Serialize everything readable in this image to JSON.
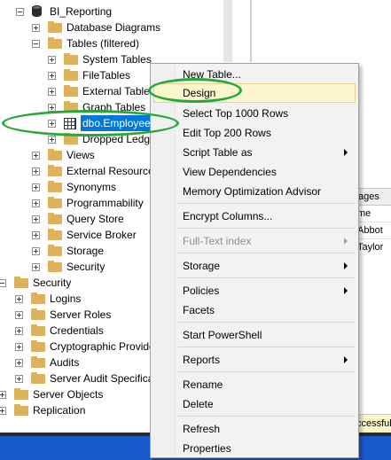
{
  "tree": {
    "items": [
      {
        "label": "BI_Reporting",
        "icon": "database-icon",
        "expander": "minus"
      },
      {
        "label": "Database Diagrams",
        "icon": "folder-icon",
        "expander": "plus"
      },
      {
        "label": "Tables (filtered)",
        "icon": "folder-icon",
        "expander": "minus"
      },
      {
        "label": "System Tables",
        "icon": "folder-icon",
        "expander": "plus"
      },
      {
        "label": "FileTables",
        "icon": "folder-icon",
        "expander": "plus"
      },
      {
        "label": "External Tables",
        "icon": "folder-icon",
        "expander": "plus"
      },
      {
        "label": "Graph Tables",
        "icon": "folder-icon",
        "expander": "plus"
      },
      {
        "label": "dbo.Employee",
        "icon": "table-icon",
        "expander": "plus",
        "selected": true
      },
      {
        "label": "Dropped Ledger",
        "icon": "folder-icon",
        "expander": "plus"
      },
      {
        "label": "Views",
        "icon": "folder-icon",
        "expander": "plus"
      },
      {
        "label": "External Resources",
        "icon": "folder-icon",
        "expander": "plus"
      },
      {
        "label": "Synonyms",
        "icon": "folder-icon",
        "expander": "plus"
      },
      {
        "label": "Programmability",
        "icon": "folder-icon",
        "expander": "plus"
      },
      {
        "label": "Query Store",
        "icon": "folder-icon",
        "expander": "plus"
      },
      {
        "label": "Service Broker",
        "icon": "folder-icon",
        "expander": "plus"
      },
      {
        "label": "Storage",
        "icon": "folder-icon",
        "expander": "plus"
      },
      {
        "label": "Security",
        "icon": "folder-icon",
        "expander": "plus"
      },
      {
        "label": "Security",
        "icon": "folder-icon",
        "expander": "minus"
      },
      {
        "label": "Logins",
        "icon": "folder-icon",
        "expander": "plus"
      },
      {
        "label": "Server Roles",
        "icon": "folder-icon",
        "expander": "plus"
      },
      {
        "label": "Credentials",
        "icon": "folder-icon",
        "expander": "plus"
      },
      {
        "label": "Cryptographic Provide",
        "icon": "folder-icon",
        "expander": "plus"
      },
      {
        "label": "Audits",
        "icon": "folder-icon",
        "expander": "plus"
      },
      {
        "label": "Server Audit Specificat",
        "icon": "folder-icon",
        "expander": "plus"
      },
      {
        "label": "Server Objects",
        "icon": "folder-icon",
        "expander": "plus"
      },
      {
        "label": "Replication",
        "icon": "folder-icon",
        "expander": "plus"
      }
    ]
  },
  "right_panel": {
    "tab_label": "ages",
    "column_header": "me",
    "rows": [
      "Abbot",
      "Taylor"
    ],
    "status_text": "ccessful"
  },
  "context_menu": {
    "items": [
      {
        "label": "New Table...",
        "has_submenu": false,
        "enabled": true
      },
      {
        "label": "Design",
        "has_submenu": false,
        "enabled": true,
        "highlighted": true
      },
      {
        "label": "Select Top 1000 Rows",
        "has_submenu": false,
        "enabled": true
      },
      {
        "label": "Edit Top 200 Rows",
        "has_submenu": false,
        "enabled": true
      },
      {
        "label": "Script Table as",
        "has_submenu": true,
        "enabled": true
      },
      {
        "label": "View Dependencies",
        "has_submenu": false,
        "enabled": true
      },
      {
        "label": "Memory Optimization Advisor",
        "has_submenu": false,
        "enabled": true
      },
      {
        "label": "Encrypt Columns...",
        "has_submenu": false,
        "enabled": true
      },
      {
        "label": "Full-Text index",
        "has_submenu": true,
        "enabled": false
      },
      {
        "label": "Storage",
        "has_submenu": true,
        "enabled": true
      },
      {
        "label": "Policies",
        "has_submenu": true,
        "enabled": true
      },
      {
        "label": "Facets",
        "has_submenu": false,
        "enabled": true
      },
      {
        "label": "Start PowerShell",
        "has_submenu": false,
        "enabled": true
      },
      {
        "label": "Reports",
        "has_submenu": true,
        "enabled": true
      },
      {
        "label": "Rename",
        "has_submenu": false,
        "enabled": true
      },
      {
        "label": "Delete",
        "has_submenu": false,
        "enabled": true
      },
      {
        "label": "Refresh",
        "has_submenu": false,
        "enabled": true
      },
      {
        "label": "Properties",
        "has_submenu": false,
        "enabled": true
      }
    ]
  },
  "colors": {
    "selection": "#0078d7",
    "annotation": "#28a83a",
    "menu_highlight": "#fcf6cf",
    "taskbar": "#1a59c9"
  }
}
